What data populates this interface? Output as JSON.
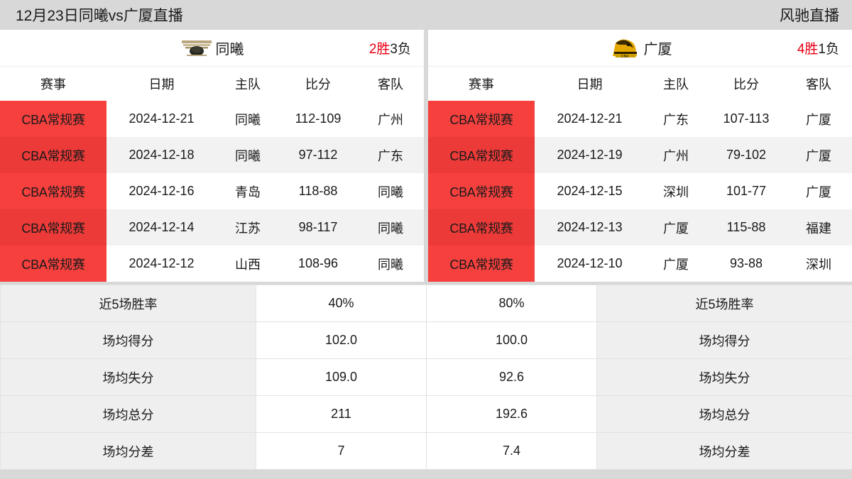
{
  "header": {
    "title": "12月23日同曦vs广厦直播",
    "brand": "风驰直播"
  },
  "left_panel": {
    "team": {
      "name": "同曦",
      "logo_icon": "tongxi-team-logo-icon",
      "record_win": "2胜",
      "record_loss": "3负"
    },
    "columns": [
      "赛事",
      "日期",
      "主队",
      "比分",
      "客队"
    ],
    "matches": [
      {
        "league": "CBA常规赛",
        "date": "2024-12-21",
        "home": "同曦",
        "score": "112-109",
        "away": "广州"
      },
      {
        "league": "CBA常规赛",
        "date": "2024-12-18",
        "home": "同曦",
        "score": "97-112",
        "away": "广东"
      },
      {
        "league": "CBA常规赛",
        "date": "2024-12-16",
        "home": "青岛",
        "score": "118-88",
        "away": "同曦"
      },
      {
        "league": "CBA常规赛",
        "date": "2024-12-14",
        "home": "江苏",
        "score": "98-117",
        "away": "同曦"
      },
      {
        "league": "CBA常规赛",
        "date": "2024-12-12",
        "home": "山西",
        "score": "108-96",
        "away": "同曦"
      }
    ]
  },
  "right_panel": {
    "team": {
      "name": "广厦",
      "logo_icon": "guangsha-team-logo-icon",
      "record_win": "4胜",
      "record_loss": "1负"
    },
    "columns": [
      "赛事",
      "日期",
      "主队",
      "比分",
      "客队"
    ],
    "matches": [
      {
        "league": "CBA常规赛",
        "date": "2024-12-21",
        "home": "广东",
        "score": "107-113",
        "away": "广厦"
      },
      {
        "league": "CBA常规赛",
        "date": "2024-12-19",
        "home": "广州",
        "score": "79-102",
        "away": "广厦"
      },
      {
        "league": "CBA常规赛",
        "date": "2024-12-15",
        "home": "深圳",
        "score": "101-77",
        "away": "广厦"
      },
      {
        "league": "CBA常规赛",
        "date": "2024-12-13",
        "home": "广厦",
        "score": "115-88",
        "away": "福建"
      },
      {
        "league": "CBA常规赛",
        "date": "2024-12-10",
        "home": "广厦",
        "score": "93-88",
        "away": "深圳"
      }
    ]
  },
  "stats": [
    {
      "left_label": "近5场胜率",
      "left_value": "40%",
      "right_value": "80%",
      "right_label": "近5场胜率"
    },
    {
      "left_label": "场均得分",
      "left_value": "102.0",
      "right_value": "100.0",
      "right_label": "场均得分"
    },
    {
      "left_label": "场均失分",
      "left_value": "109.0",
      "right_value": "92.6",
      "right_label": "场均失分"
    },
    {
      "left_label": "场均总分",
      "left_value": "211",
      "right_value": "192.6",
      "right_label": "场均总分"
    },
    {
      "left_label": "场均分差",
      "left_value": "7",
      "right_value": "7.4",
      "right_label": "场均分差"
    }
  ],
  "colors": {
    "league_badge_odd": "#f5403e",
    "league_badge_even": "#ec3a38",
    "win_text": "#e60012",
    "page_background": "#d8d8d8",
    "stat_label_background": "#efefef"
  }
}
